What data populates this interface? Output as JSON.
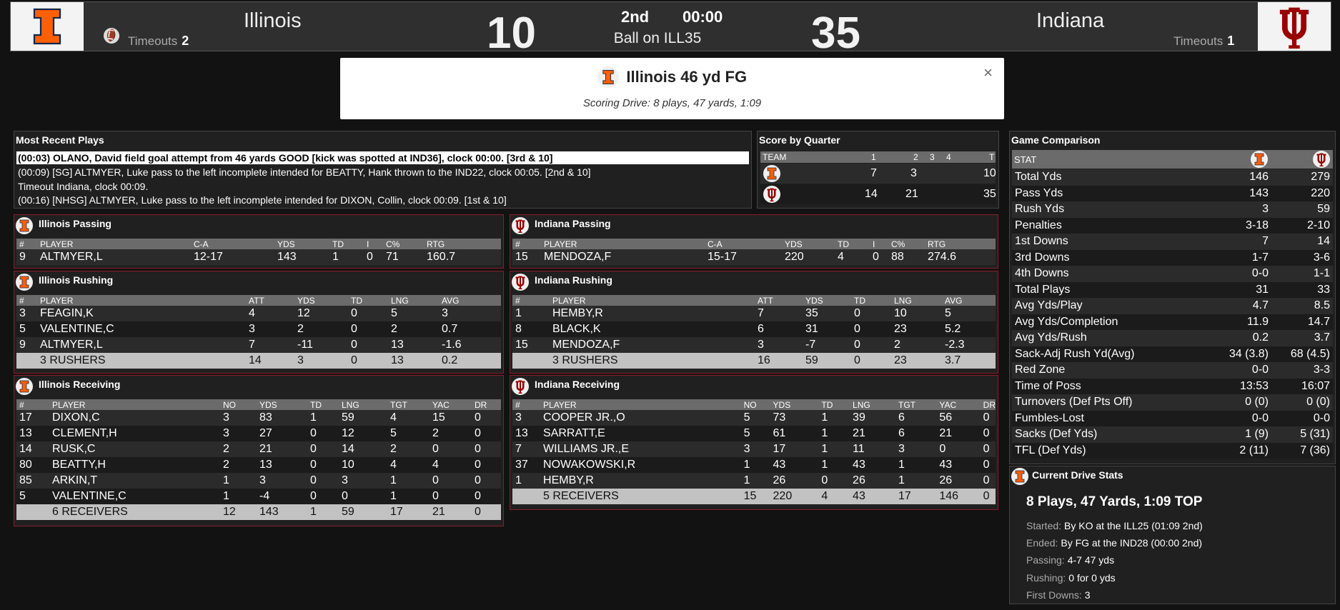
{
  "header": {
    "home": {
      "name": "Illinois",
      "score": "10",
      "timeouts_label": "Timeouts",
      "timeouts": "2"
    },
    "away": {
      "name": "Indiana",
      "score": "35",
      "timeouts_label": "Timeouts",
      "timeouts": "1"
    },
    "quarter": "2nd",
    "clock": "00:00",
    "ball_on": "Ball on ILL35"
  },
  "banner": {
    "title": "Illinois 46 yd FG",
    "subtitle": "Scoring Drive: 8 plays, 47 yards, 1:09",
    "close": "×"
  },
  "recent": {
    "title": "Most Recent Plays",
    "plays": [
      "(00:03) OLANO, David field goal attempt from 46 yards GOOD [kick was spotted at IND36], clock 00:00. [3rd & 10]",
      "(00:09) [SG] ALTMYER, Luke pass to the left incomplete intended for BEATTY, Hank thrown to the IND22, clock 00:05. [2nd & 10]",
      "Timeout Indiana, clock 00:09.",
      "(00:16) [NHSG] ALTMYER, Luke pass to the left incomplete intended for DIXON, Collin, clock 00:09. [1st & 10]"
    ]
  },
  "sbq": {
    "title": "Score by Quarter",
    "head": [
      "TEAM",
      "1",
      "2",
      "3",
      "4",
      "T"
    ],
    "rows": [
      [
        "7",
        "3",
        "",
        "",
        "10"
      ],
      [
        "14",
        "21",
        "",
        "",
        "35"
      ]
    ]
  },
  "ill_pass": {
    "title": "Illinois Passing",
    "head": [
      "#",
      "PLAYER",
      "C-A",
      "YDS",
      "TD",
      "I",
      "C%",
      "RTG"
    ],
    "rows": [
      [
        "9",
        "ALTMYER,L",
        "12-17",
        "143",
        "1",
        "0",
        "71",
        "160.7"
      ]
    ]
  },
  "ind_pass": {
    "title": "Indiana Passing",
    "head": [
      "#",
      "PLAYER",
      "C-A",
      "YDS",
      "TD",
      "I",
      "C%",
      "RTG"
    ],
    "rows": [
      [
        "15",
        "MENDOZA,F",
        "15-17",
        "220",
        "4",
        "0",
        "88",
        "274.6"
      ]
    ]
  },
  "ill_rush": {
    "title": "Illinois Rushing",
    "head": [
      "#",
      "PLAYER",
      "ATT",
      "YDS",
      "TD",
      "LNG",
      "AVG"
    ],
    "rows": [
      [
        "3",
        "FEAGIN,K",
        "4",
        "12",
        "0",
        "5",
        "3"
      ],
      [
        "5",
        "VALENTINE,C",
        "3",
        "2",
        "0",
        "2",
        "0.7"
      ],
      [
        "9",
        "ALTMYER,L",
        "7",
        "-11",
        "0",
        "13",
        "-1.6"
      ],
      [
        "",
        "3 RUSHERS",
        "14",
        "3",
        "0",
        "13",
        "0.2"
      ]
    ]
  },
  "ind_rush": {
    "title": "Indiana Rushing",
    "head": [
      "#",
      "PLAYER",
      "ATT",
      "YDS",
      "TD",
      "LNG",
      "AVG"
    ],
    "rows": [
      [
        "1",
        "HEMBY,R",
        "7",
        "35",
        "0",
        "10",
        "5"
      ],
      [
        "8",
        "BLACK,K",
        "6",
        "31",
        "0",
        "23",
        "5.2"
      ],
      [
        "15",
        "MENDOZA,F",
        "3",
        "-7",
        "0",
        "2",
        "-2.3"
      ],
      [
        "",
        "3 RUSHERS",
        "16",
        "59",
        "0",
        "23",
        "3.7"
      ]
    ]
  },
  "ill_rec": {
    "title": "Illinois Receiving",
    "head": [
      "#",
      "PLAYER",
      "NO",
      "YDS",
      "TD",
      "LNG",
      "TGT",
      "YAC",
      "DR"
    ],
    "rows": [
      [
        "17",
        "DIXON,C",
        "3",
        "83",
        "1",
        "59",
        "4",
        "15",
        "0"
      ],
      [
        "13",
        "CLEMENT,H",
        "3",
        "27",
        "0",
        "12",
        "5",
        "2",
        "0"
      ],
      [
        "14",
        "RUSK,C",
        "2",
        "21",
        "0",
        "14",
        "2",
        "0",
        "0"
      ],
      [
        "80",
        "BEATTY,H",
        "2",
        "13",
        "0",
        "10",
        "4",
        "4",
        "0"
      ],
      [
        "85",
        "ARKIN,T",
        "1",
        "3",
        "0",
        "3",
        "1",
        "0",
        "0"
      ],
      [
        "5",
        "VALENTINE,C",
        "1",
        "-4",
        "0",
        "0",
        "1",
        "0",
        "0"
      ],
      [
        "",
        "6 RECEIVERS",
        "12",
        "143",
        "1",
        "59",
        "17",
        "21",
        "0"
      ]
    ]
  },
  "ind_rec": {
    "title": "Indiana Receiving",
    "head": [
      "#",
      "PLAYER",
      "NO",
      "YDS",
      "TD",
      "LNG",
      "TGT",
      "YAC",
      "DR"
    ],
    "rows": [
      [
        "3",
        "COOPER JR.,O",
        "5",
        "73",
        "1",
        "39",
        "6",
        "56",
        "0"
      ],
      [
        "13",
        "SARRATT,E",
        "5",
        "61",
        "1",
        "21",
        "6",
        "21",
        "0"
      ],
      [
        "7",
        "WILLIAMS JR.,E",
        "3",
        "17",
        "1",
        "11",
        "3",
        "0",
        "0"
      ],
      [
        "37",
        "NOWAKOWSKI,R",
        "1",
        "43",
        "1",
        "43",
        "1",
        "43",
        "0"
      ],
      [
        "1",
        "HEMBY,R",
        "1",
        "26",
        "0",
        "26",
        "1",
        "26",
        "0"
      ],
      [
        "",
        "5 RECEIVERS",
        "15",
        "220",
        "4",
        "43",
        "17",
        "146",
        "0"
      ]
    ]
  },
  "gc": {
    "title": "Game Comparison",
    "stat_label": "STAT",
    "rows": [
      [
        "Total Yds",
        "146",
        "279"
      ],
      [
        "Pass Yds",
        "143",
        "220"
      ],
      [
        "Rush Yds",
        "3",
        "59"
      ],
      [
        "Penalties",
        "3-18",
        "2-10"
      ],
      [
        "1st Downs",
        "7",
        "14"
      ],
      [
        "3rd Downs",
        "1-7",
        "3-6"
      ],
      [
        "4th Downs",
        "0-0",
        "1-1"
      ],
      [
        "Total Plays",
        "31",
        "33"
      ],
      [
        "Avg Yds/Play",
        "4.7",
        "8.5"
      ],
      [
        "Avg Yds/Completion",
        "11.9",
        "14.7"
      ],
      [
        "Avg Yds/Rush",
        "0.2",
        "3.7"
      ],
      [
        "Sack-Adj Rush Yd(Avg)",
        "34 (3.8)",
        "68 (4.5)"
      ],
      [
        "Red Zone",
        "0-0",
        "3-3"
      ],
      [
        "Time of Poss",
        "13:53",
        "16:07"
      ],
      [
        "Turnovers (Def Pts Off)",
        "0 (0)",
        "0 (0)"
      ],
      [
        "Fumbles-Lost",
        "0-0",
        "0-0"
      ],
      [
        "Sacks (Def Yds)",
        "1 (9)",
        "5 (31)"
      ],
      [
        "TFL (Def Yds)",
        "2 (11)",
        "7 (36)"
      ]
    ]
  },
  "drive": {
    "title": "Current Drive Stats",
    "summary": "8 Plays, 47 Yards, 1:09 TOP",
    "items": [
      {
        "label": "Started:",
        "value": "By KO at the ILL25 (01:09 2nd)"
      },
      {
        "label": "Ended:",
        "value": "By FG at the IND28 (00:00 2nd)"
      },
      {
        "label": "Passing:",
        "value": "4-7 47 yds"
      },
      {
        "label": "Rushing:",
        "value": "0 for 0 yds"
      },
      {
        "label": "First Downs:",
        "value": "3"
      }
    ]
  },
  "colors": {
    "illinois_orange": "#ff5f05",
    "illinois_navy": "#13294b",
    "indiana_crimson": "#990000",
    "panel_border_red": "#8b1d2c"
  }
}
